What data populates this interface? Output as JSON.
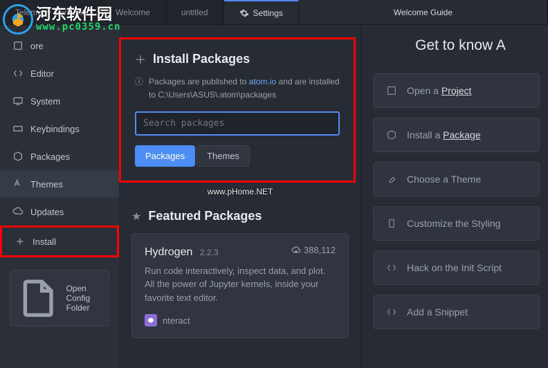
{
  "tabs": {
    "telemetry": "Telemetry Consent",
    "welcome": "Welcome",
    "untitled": "untitled",
    "settings": "Settings",
    "guide": "Welcome Guide"
  },
  "sidebar": {
    "core": "ore",
    "editor": "Editor",
    "system": "System",
    "keybindings": "Keybindings",
    "packages": "Packages",
    "themes": "Themes",
    "updates": "Updates",
    "install": "Install",
    "openConfig": "Open Config Folder"
  },
  "installPanel": {
    "title": "Install Packages",
    "info_pre": "Packages are published to ",
    "info_link": "atom.io",
    "info_post": " and are installed to C:\\Users\\ASUS\\.atom\\packages",
    "searchPlaceholder": "Search packages",
    "btnPackages": "Packages",
    "btnThemes": "Themes"
  },
  "watermark_center": "www.pHome.NET",
  "featured": {
    "title": "Featured Packages",
    "card": {
      "name": "Hydrogen",
      "version": "2.2.3",
      "downloads": "388,112",
      "desc": "Run code interactively, inspect data, and plot. All the power of Jupyter kernels, inside your favorite text editor.",
      "author": "nteract"
    }
  },
  "guide": {
    "title": "Get to know A",
    "items": {
      "project_pre": "Open a ",
      "project_u": "Project",
      "package_pre": "Install a ",
      "package_u": "Package",
      "theme": "Choose a Theme",
      "styling": "Customize the Styling",
      "init": "Hack on the Init Script",
      "snippet": "Add a Snippet"
    }
  },
  "overlay": {
    "cn": "河东软件园",
    "url": "www.pc0359.cn"
  }
}
